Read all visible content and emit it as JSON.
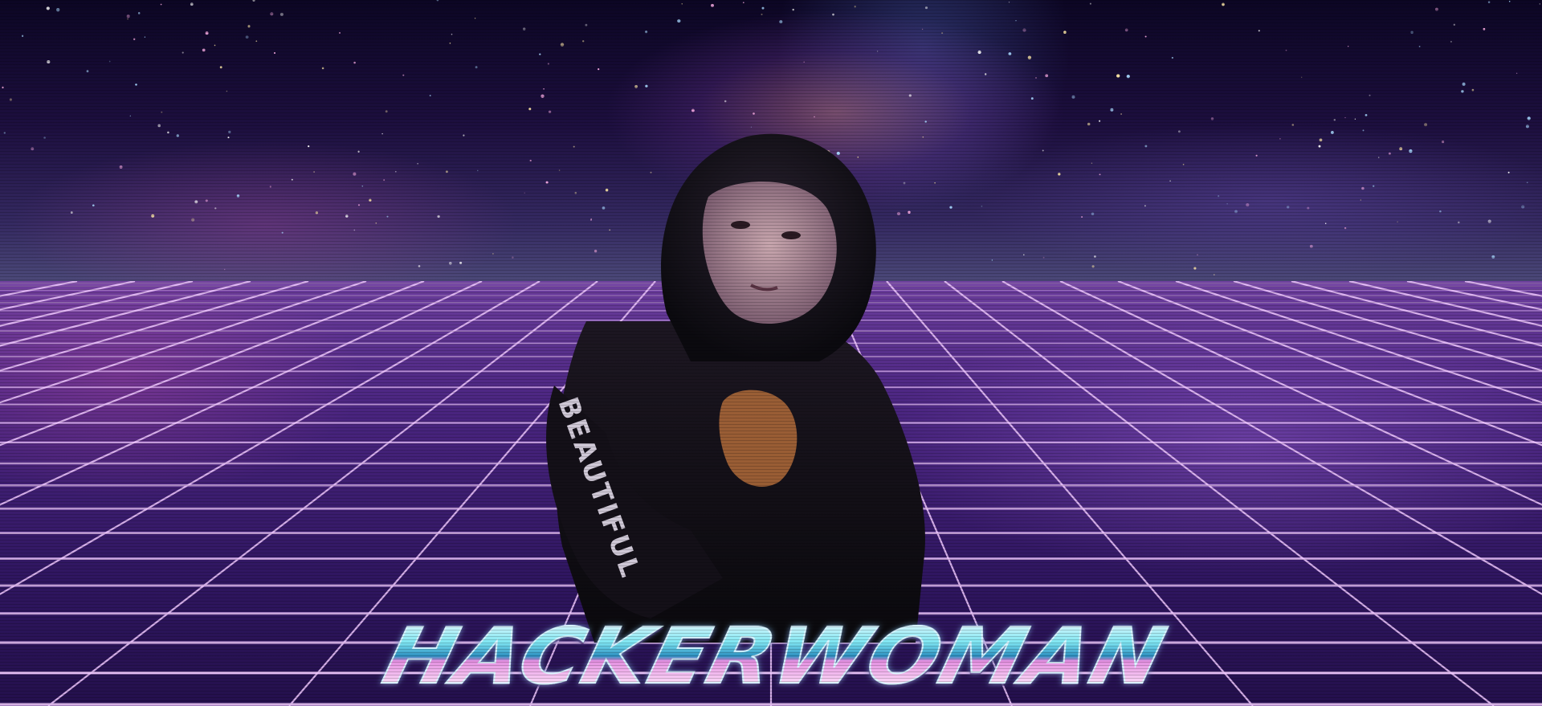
{
  "logo": {
    "text": "HACKERWOMAN"
  },
  "figure": {
    "sleeve_text": "BEAUTIFUL"
  },
  "colors": {
    "grid_line": "#f0c8ff",
    "sky_top": "#0c0624",
    "ground": "#4a2580",
    "logo_cyan": "#7fe6f2",
    "logo_pink": "#e38ee0"
  }
}
